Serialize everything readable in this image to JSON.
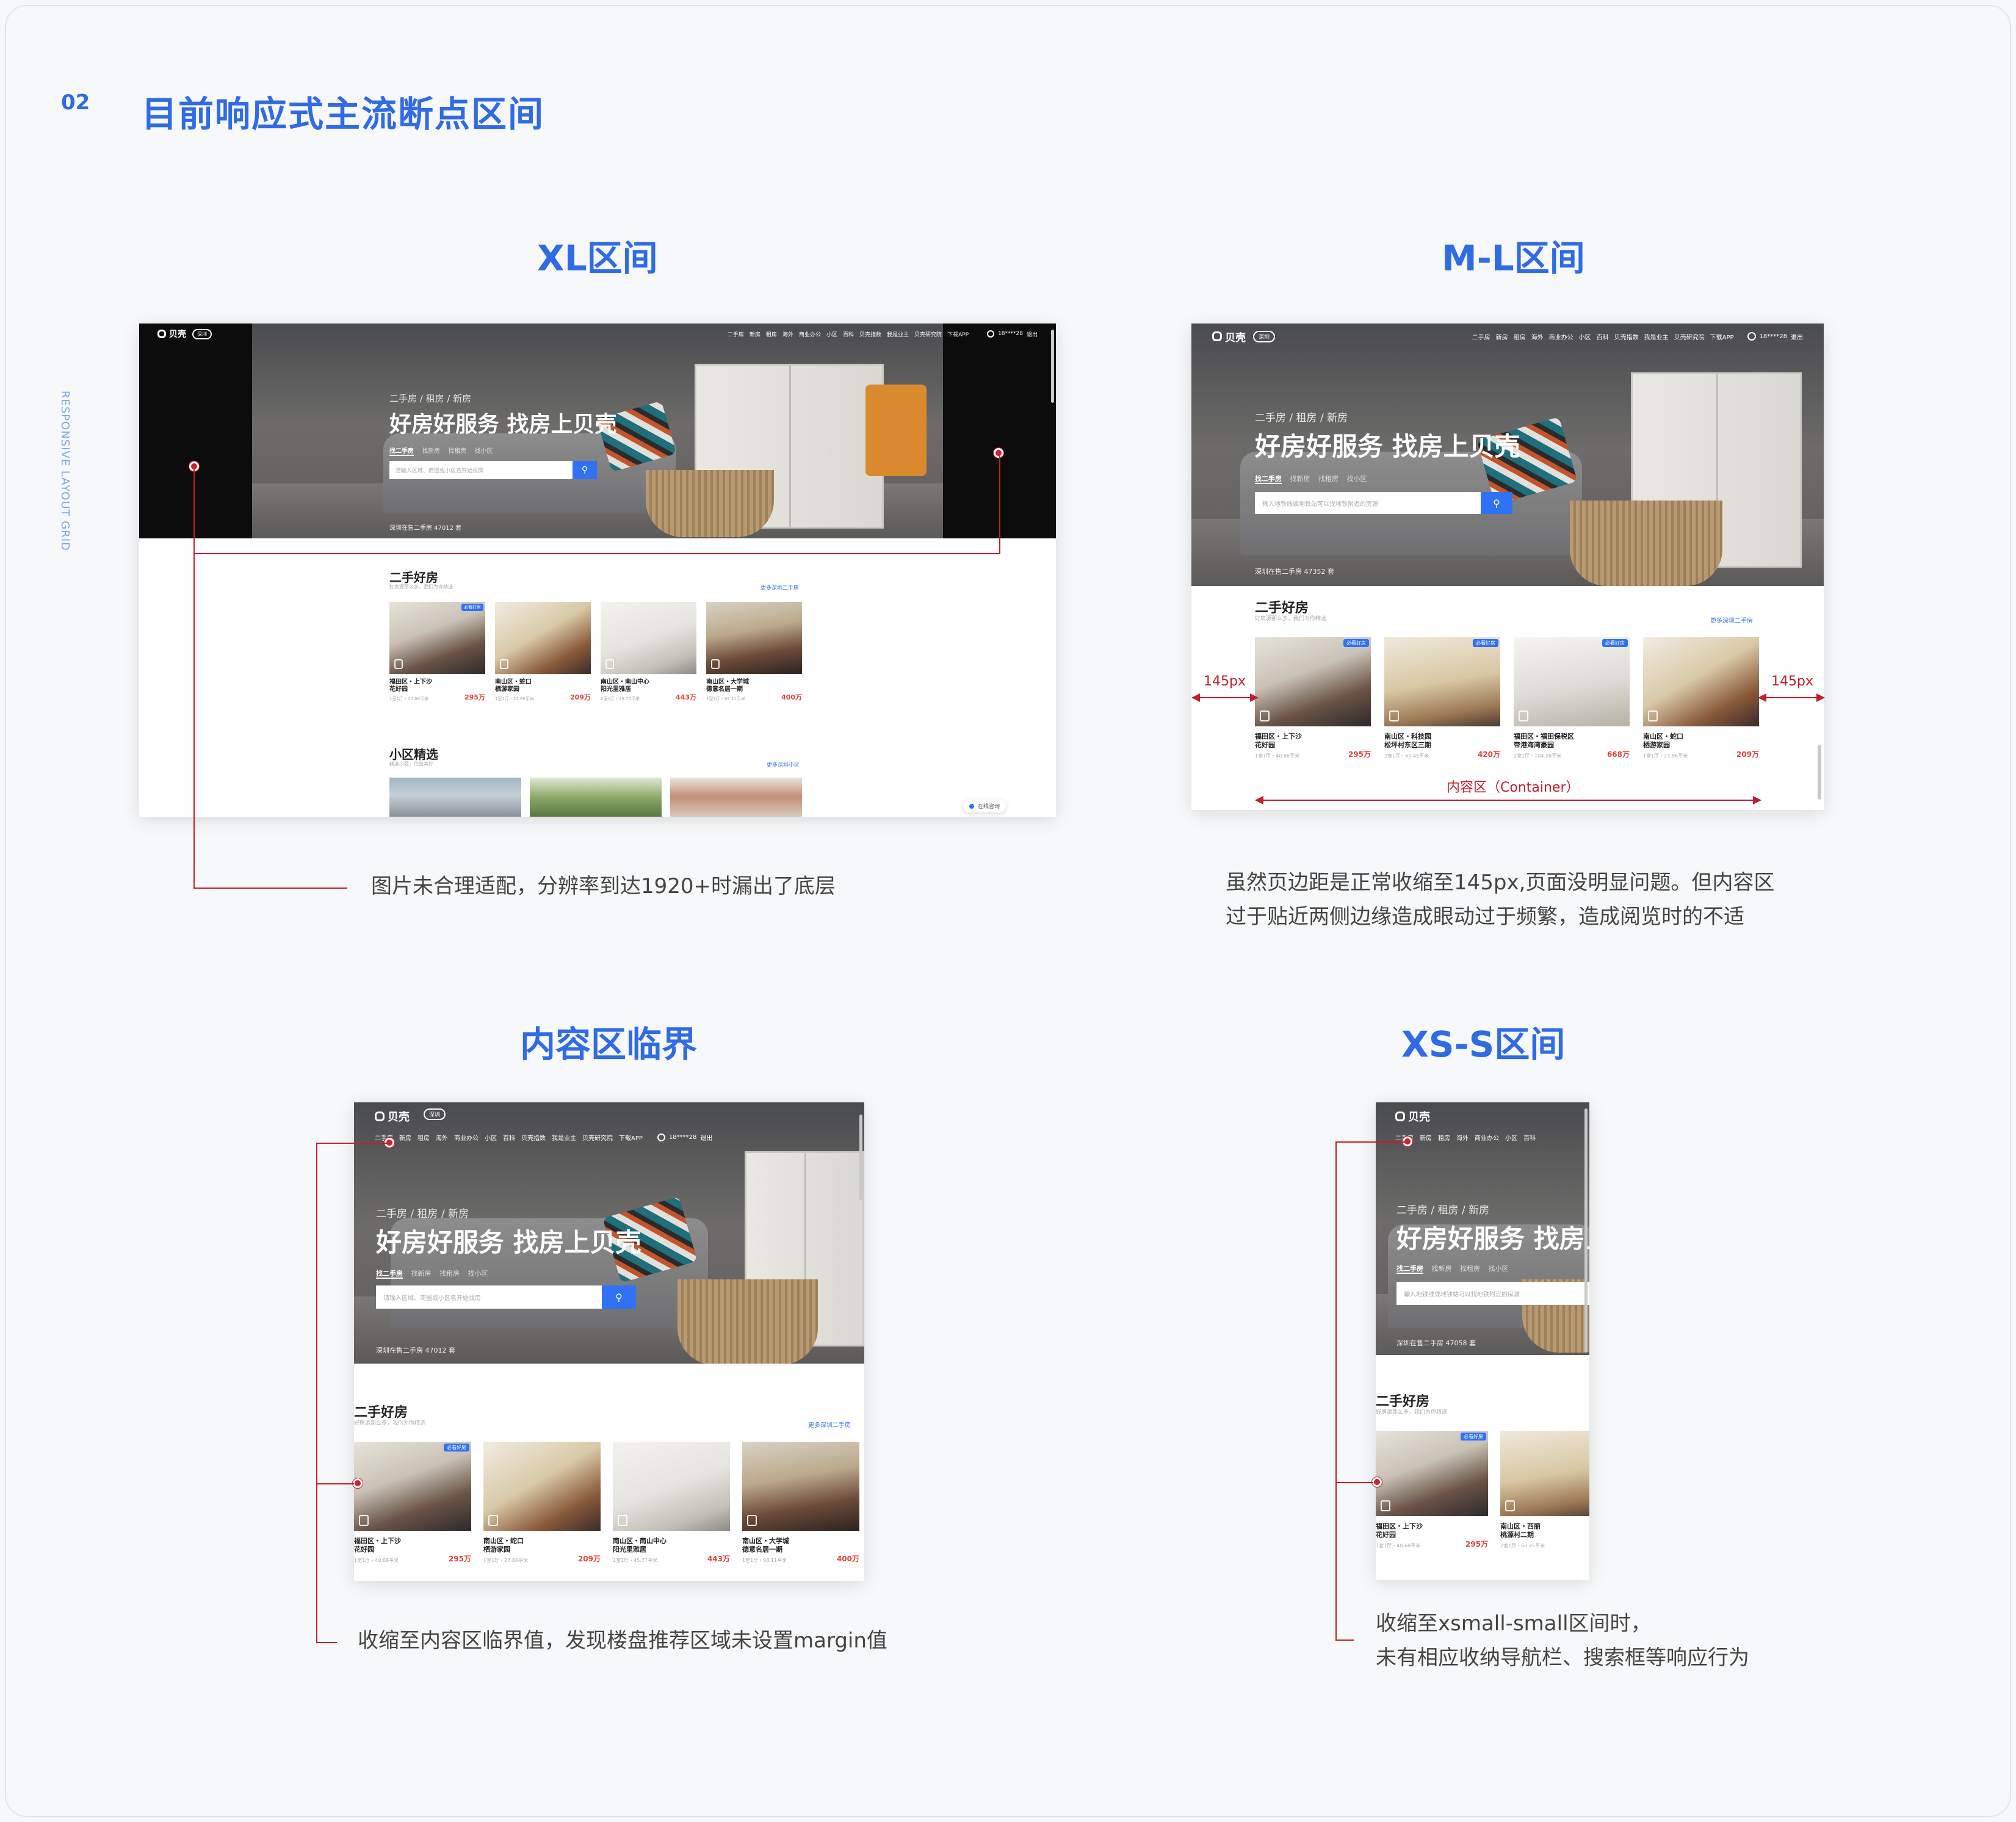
{
  "header": {
    "number": "02",
    "title": "目前响应式主流断点区间",
    "side_label": "RESPONSIVE LAYOUT GRID"
  },
  "sections": {
    "xl": {
      "title": "XL区间",
      "caption": "图片未合理适配，分辨率到达1920+时漏出了底层"
    },
    "ml": {
      "title": "M-L区间",
      "caption_line1": "虽然页边距是正常收缩至145px,页面没明显问题。但内容区",
      "caption_line2": "过于贴近两侧边缘造成眼动过于频繁，造成阅览时的不适",
      "margin_label": "145px",
      "container_label": "内容区（Container）"
    },
    "critical": {
      "title": "内容区临界",
      "caption": "收缩至内容区临界值，发现楼盘推荐区域未设置margin值"
    },
    "xs": {
      "title": "XS-S区间",
      "caption_line1": "收缩至xsmall-small区间时，",
      "caption_line2": "未有相应收纳导航栏、搜索框等响应行为"
    }
  },
  "site": {
    "logo": "贝壳",
    "city": "深圳",
    "nav": [
      "二手房",
      "新房",
      "租房",
      "海外",
      "商业办公",
      "小区",
      "百科",
      "贝壳指数",
      "我是业主",
      "贝壳研究院",
      "下载APP"
    ],
    "user": "18****28",
    "logout": "退出",
    "hero_tabs": "二手房   /   租房   /   新房",
    "hero_title": "好房好服务 找房上贝壳",
    "search_tabs": [
      "找二手房",
      "找新房",
      "找租房",
      "找小区"
    ],
    "search_placeholder": "请输入区域、商圈或小区名开始找房",
    "search_placeholder_alt": "输入地铁线或地铁站可以找地铁附近的房源",
    "hero_foot_1": "深圳在售二手房 47012 套",
    "hero_foot_2": "深圳在售二手房 47352 套",
    "hero_foot_3": "深圳在售二手房 47058 套",
    "section1_title": "二手好房",
    "section1_sub": "好房源那么多，我们为你精选",
    "section1_more": "更多深圳二手房",
    "section2_title": "小区精选",
    "section2_sub": "精选小区，住出美好",
    "section2_more": "更多深圳小区",
    "tag": "必看好房",
    "online": "在线咨询",
    "cards": [
      {
        "name": "福田区・上下沙\n花好园",
        "meta": "1室1厅・40.68平米",
        "price": "295万"
      },
      {
        "name": "南山区・蛇口\n栖游家园",
        "meta": "1室1厅・27.86平米",
        "price": "209万"
      },
      {
        "name": "南山区・南山中心\n阳光里雅居",
        "meta": "2室1厅・45.77平米",
        "price": "443万"
      },
      {
        "name": "南山区・大学城\n德意名居一期",
        "meta": "1室1厅・68.11平米",
        "price": "400万"
      }
    ],
    "cards_ml": [
      {
        "name": "福田区・上下沙\n花好园",
        "meta": "1室1厅・40.68平米",
        "price": "295万"
      },
      {
        "name": "南山区・科技园\n松坪村东区三期",
        "meta": "2室1厅・60.45平米",
        "price": "420万"
      },
      {
        "name": "福田区・福田保税区\n帝港海湾豪园",
        "meta": "2室2厅・104.06平米",
        "price": "668万"
      },
      {
        "name": "南山区・蛇口\n栖游家园",
        "meta": "1室1厅・27.86平米",
        "price": "209万"
      }
    ],
    "cards_xs": [
      {
        "name": "福田区・上下沙\n花好园",
        "meta": "1室1厅・40.68平米",
        "price": "295万"
      },
      {
        "name": "南山区・西丽\n桃源村二期",
        "meta": "2室1厅・60.45平米",
        "price": ""
      }
    ]
  },
  "colors": {
    "accent": "#2f6be6",
    "annotation_red": "#c51d2b",
    "price_red": "#e5443d",
    "search_blue": "#3072f6"
  }
}
